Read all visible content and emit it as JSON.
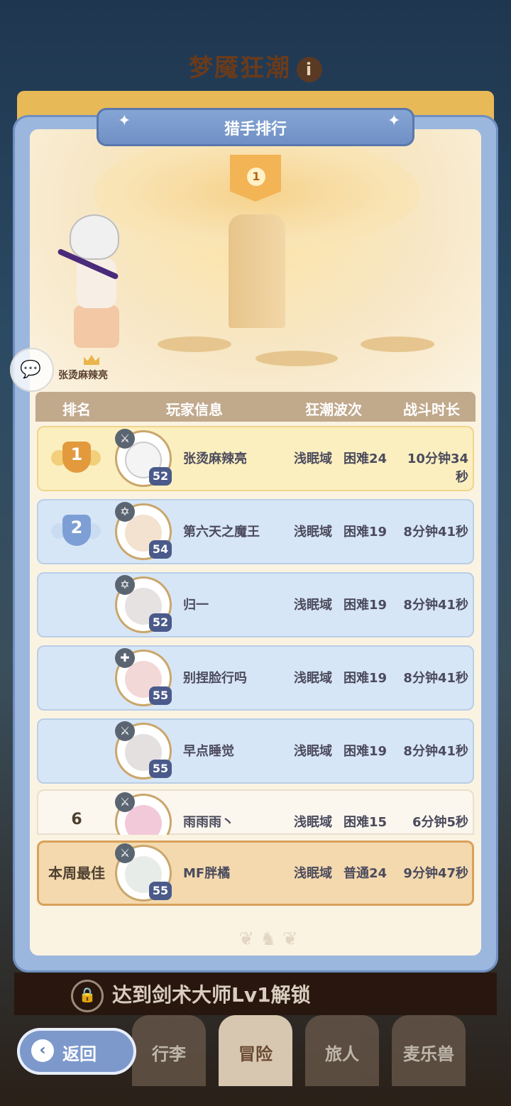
{
  "background": {
    "title": "梦魇狂潮",
    "info_icon": "info-icon",
    "lock_message": "达到剑术大师Lv1解锁",
    "nav": [
      {
        "label": "行李"
      },
      {
        "label": "冒险"
      },
      {
        "label": "旅人"
      },
      {
        "label": "麦乐兽"
      }
    ],
    "back_label": "返回"
  },
  "panel": {
    "title": "猎手排行",
    "top_rank_flag": "1",
    "champion_name": "张烫麻辣亮",
    "columns": [
      "排名",
      "玩家信息",
      "狂潮波次",
      "战斗时长"
    ]
  },
  "rows": [
    {
      "rank": "1",
      "name": "张烫麻辣亮",
      "region": "浅眠域",
      "difficulty": "困难24",
      "time": "10分钟34秒",
      "level": "52",
      "style": "gold"
    },
    {
      "rank": "2",
      "name": "第六天之魔王",
      "region": "浅眠域",
      "difficulty": "困难19",
      "time": "8分钟41秒",
      "level": "54",
      "style": "blue"
    },
    {
      "rank": "",
      "name": "归一",
      "region": "浅眠域",
      "difficulty": "困难19",
      "time": "8分钟41秒",
      "level": "52",
      "style": "blue"
    },
    {
      "rank": "",
      "name": "别捏脸行吗",
      "region": "浅眠域",
      "difficulty": "困难19",
      "time": "8分钟41秒",
      "level": "55",
      "style": "blue"
    },
    {
      "rank": "",
      "name": "早点睡觉",
      "region": "浅眠域",
      "difficulty": "困难19",
      "time": "8分钟41秒",
      "level": "55",
      "style": "blue"
    },
    {
      "rank": "6",
      "name": "雨雨雨丶",
      "region": "浅眠域",
      "difficulty": "困难15",
      "time": "6分钟5秒",
      "level": "",
      "style": "cream"
    }
  ],
  "best": {
    "label": "本周最佳",
    "name": "MF胖橘",
    "region": "浅眠域",
    "difficulty": "普通24",
    "time": "9分钟47秒",
    "level": "55"
  },
  "colors": {
    "gold_row": "#fbefbf",
    "blue_row": "#d7e6f6",
    "best_row": "#f4d9ae",
    "header": "#c1a98c"
  }
}
